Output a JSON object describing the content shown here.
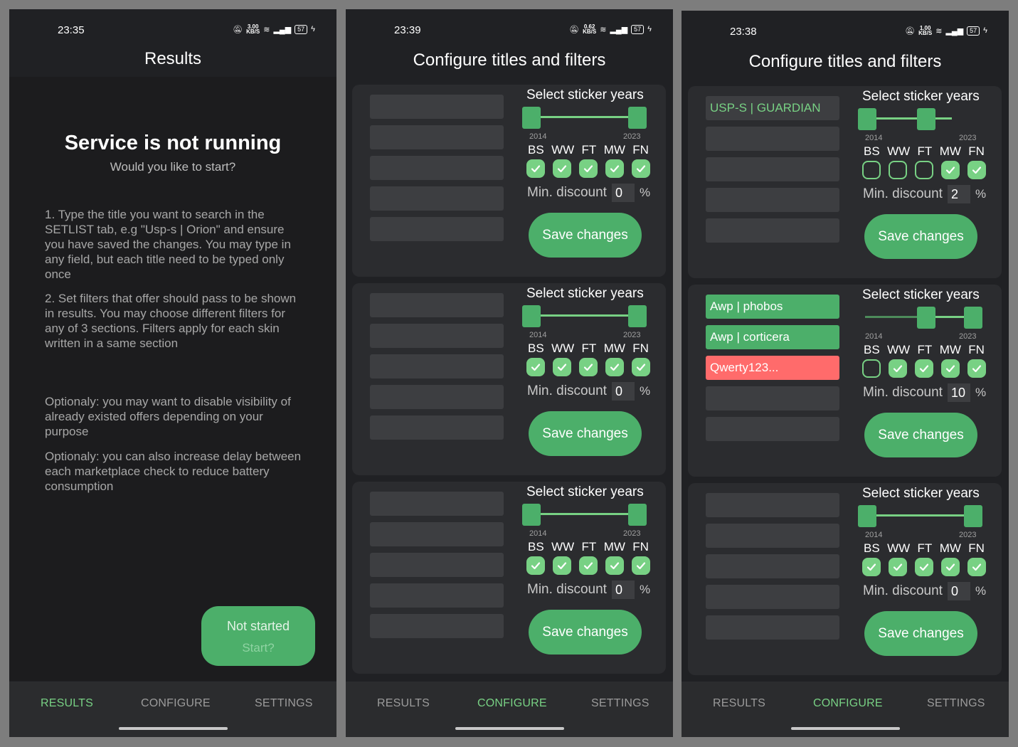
{
  "screens": [
    {
      "status": {
        "time": "23:35",
        "speed": "3.00",
        "speed_unit": "KB/S",
        "battery": "57"
      },
      "header": {
        "title": "Results"
      },
      "main": {
        "service_title": "Service is not running",
        "service_sub": "Would you like to start?",
        "instructions": [
          "1. Type the title you want to search in the SETLIST tab, e.g \"Usp-s | Orion\" and ensure you have saved the changes. You may type in any field, but each title need to be typed only once",
          "2. Set filters that offer should pass to be shown in results. You may choose different filters for any of 3 sections. Filters apply for each skin written in a same section",
          "Optionaly: you may want to disable visibility of already existed offers depending on your purpose",
          "Optionaly: you can also increase delay between each marketplace check to reduce battery consumption"
        ],
        "start_button": {
          "label": "Not started",
          "sub": "Start?"
        }
      },
      "nav": {
        "results": "RESULTS",
        "configure": "CONFIGURE",
        "settings": "SETTINGS",
        "active": "results"
      }
    },
    {
      "status": {
        "time": "23:39",
        "speed": "0.62",
        "speed_unit": "KB/S",
        "battery": "57"
      },
      "header": {
        "title": "Configure titles and filters"
      },
      "cards": [
        {
          "titles": [
            "",
            "",
            "",
            "",
            ""
          ],
          "sticker_label": "Select sticker years",
          "year_min": "2014",
          "year_max": "2023",
          "conditions": [
            {
              "label": "BS",
              "checked": true
            },
            {
              "label": "WW",
              "checked": true
            },
            {
              "label": "FT",
              "checked": true
            },
            {
              "label": "MW",
              "checked": true
            },
            {
              "label": "FN",
              "checked": true
            }
          ],
          "min_discount_label": "Min. discount",
          "min_discount": "0",
          "pct": "%",
          "save": "Save changes"
        },
        {
          "titles": [
            "",
            "",
            "",
            "",
            ""
          ],
          "sticker_label": "Select sticker years",
          "year_min": "2014",
          "year_max": "2023",
          "conditions": [
            {
              "label": "BS",
              "checked": true
            },
            {
              "label": "WW",
              "checked": true
            },
            {
              "label": "FT",
              "checked": true
            },
            {
              "label": "MW",
              "checked": true
            },
            {
              "label": "FN",
              "checked": true
            }
          ],
          "min_discount_label": "Min. discount",
          "min_discount": "0",
          "pct": "%",
          "save": "Save changes"
        },
        {
          "titles": [
            "",
            "",
            "",
            "",
            ""
          ],
          "sticker_label": "Select sticker years",
          "year_min": "2014",
          "year_max": "2023",
          "conditions": [
            {
              "label": "BS",
              "checked": true
            },
            {
              "label": "WW",
              "checked": true
            },
            {
              "label": "FT",
              "checked": true
            },
            {
              "label": "MW",
              "checked": true
            },
            {
              "label": "FN",
              "checked": true
            }
          ],
          "min_discount_label": "Min. discount",
          "min_discount": "0",
          "pct": "%",
          "save": "Save changes"
        }
      ],
      "nav": {
        "results": "RESULTS",
        "configure": "CONFIGURE",
        "settings": "SETTINGS",
        "active": "configure"
      }
    },
    {
      "status": {
        "time": "23:38",
        "speed": "1.00",
        "speed_unit": "KB/S",
        "battery": "57"
      },
      "header": {
        "title": "Configure titles and filters"
      },
      "cards": [
        {
          "titles": [
            "USP-S | GUARDIAN",
            "",
            "",
            "",
            ""
          ],
          "sticker_label": "Select sticker years",
          "year_min": "2014",
          "year_max": "2023",
          "conditions": [
            {
              "label": "BS",
              "checked": false
            },
            {
              "label": "WW",
              "checked": false
            },
            {
              "label": "FT",
              "checked": false
            },
            {
              "label": "MW",
              "checked": true
            },
            {
              "label": "FN",
              "checked": true
            }
          ],
          "min_discount_label": "Min. discount",
          "min_discount": "2",
          "pct": "%",
          "save": "Save changes"
        },
        {
          "titles": [
            "Awp | phobos",
            "Awp | corticera",
            "Qwerty123...",
            "",
            ""
          ],
          "sticker_label": "Select sticker years",
          "year_min": "2014",
          "year_max": "2023",
          "conditions": [
            {
              "label": "BS",
              "checked": false
            },
            {
              "label": "WW",
              "checked": true
            },
            {
              "label": "FT",
              "checked": true
            },
            {
              "label": "MW",
              "checked": true
            },
            {
              "label": "FN",
              "checked": true
            }
          ],
          "min_discount_label": "Min. discount",
          "min_discount": "10",
          "pct": "%",
          "save": "Save changes"
        },
        {
          "titles": [
            "",
            "",
            "",
            "",
            ""
          ],
          "sticker_label": "Select sticker years",
          "year_min": "2014",
          "year_max": "2023",
          "conditions": [
            {
              "label": "BS",
              "checked": true
            },
            {
              "label": "WW",
              "checked": true
            },
            {
              "label": "FT",
              "checked": true
            },
            {
              "label": "MW",
              "checked": true
            },
            {
              "label": "FN",
              "checked": true
            }
          ],
          "min_discount_label": "Min. discount",
          "min_discount": "0",
          "pct": "%",
          "save": "Save changes"
        }
      ],
      "nav": {
        "results": "RESULTS",
        "configure": "CONFIGURE",
        "settings": "SETTINGS",
        "active": "configure"
      }
    }
  ],
  "colors": {
    "accent": "#4caf6a",
    "accent_light": "#78d184",
    "error": "#ff6b6b",
    "bg": "#202124",
    "card": "#2b2c2f"
  }
}
